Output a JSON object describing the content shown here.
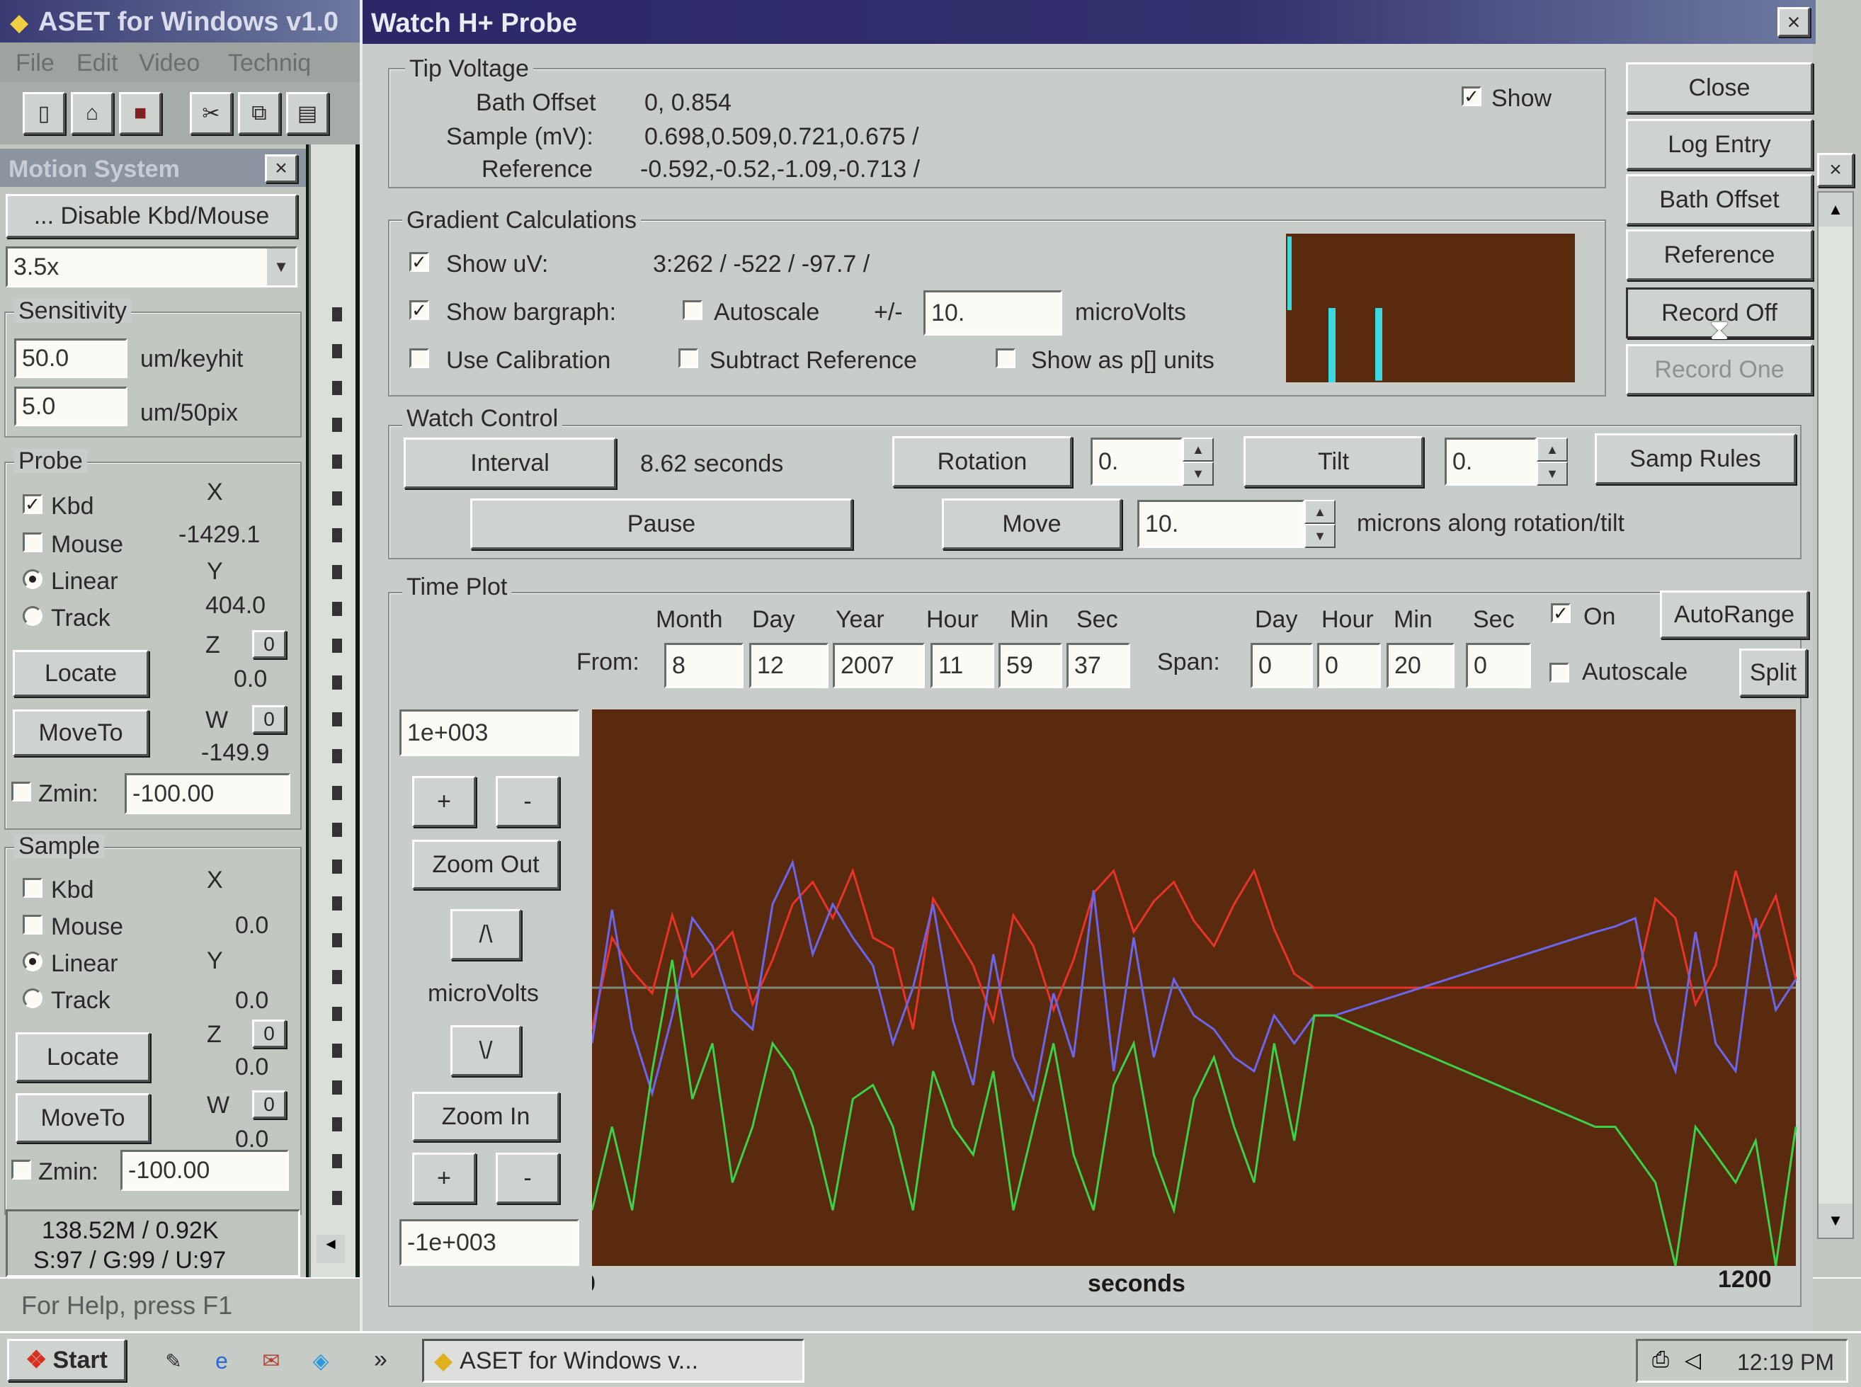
{
  "app": {
    "title": "ASET for Windows v1.0",
    "menu": [
      "File",
      "Edit",
      "Video",
      "Techniq"
    ],
    "status": "For Help, press F1"
  },
  "motion": {
    "title": "Motion System",
    "disable_btn": "... Disable Kbd/Mouse",
    "mag": "3.5x",
    "sensitivity": {
      "title": "Sensitivity",
      "v1": "50.0",
      "u1": "um/keyhit",
      "v2": "5.0",
      "u2": "um/50pix"
    },
    "probe": {
      "title": "Probe",
      "kbd": "Kbd",
      "mouse": "Mouse",
      "linear": "Linear",
      "track": "Track",
      "x_lbl": "X",
      "x": "-1429.1",
      "y_lbl": "Y",
      "y": "404.0",
      "z_lbl": "Z",
      "z": "0.0",
      "w_lbl": "W",
      "w": "-149.9",
      "zero": "0",
      "locate": "Locate",
      "moveto": "MoveTo",
      "zmin_lbl": "Zmin:",
      "zmin": "-100.00"
    },
    "sample": {
      "title": "Sample",
      "kbd": "Kbd",
      "mouse": "Mouse",
      "linear": "Linear",
      "track": "Track",
      "x_lbl": "X",
      "x": "0.0",
      "y_lbl": "Y",
      "y": "0.0",
      "z_lbl": "Z",
      "z": "0.0",
      "w_lbl": "W",
      "w": "0.0",
      "zero": "0",
      "locate": "Locate",
      "moveto": "MoveTo",
      "zmin_lbl": "Zmin:",
      "zmin": "-100.00"
    },
    "mem1": "138.52M / 0.92K",
    "mem2": "S:97 / G:99 / U:97"
  },
  "dialog": {
    "title": "Watch H+ Probe",
    "close_x": "×",
    "tip": {
      "title": "Tip Voltage",
      "bath_lbl": "Bath Offset",
      "bath": "0, 0.854",
      "sample_lbl": "Sample (mV):",
      "sample": "0.698,0.509,0.721,0.675 /",
      "ref_lbl": "Reference",
      "ref": "-0.592,-0.52,-1.09,-0.713 /",
      "show": "Show"
    },
    "grad": {
      "title": "Gradient Calculations",
      "show_uv": "Show uV:",
      "uv_values": "3:262 / -522 / -97.7 /",
      "show_bar": "Show bargraph:",
      "autoscale": "Autoscale",
      "pm": "+/-",
      "range": "10.",
      "microvolts": "microVolts",
      "use_cal": "Use Calibration",
      "sub_ref": "Subtract Reference",
      "show_p": "Show as p[] units"
    },
    "watch": {
      "title": "Watch Control",
      "interval_btn": "Interval",
      "interval": "8.62 seconds",
      "rotation_btn": "Rotation",
      "rotation": "0.",
      "tilt_btn": "Tilt",
      "tilt": "0.",
      "samp_rules": "Samp Rules",
      "pause": "Pause",
      "move": "Move",
      "move_val": "10.",
      "move_unit": "microns along rotation/tilt"
    },
    "time": {
      "title": "Time Plot",
      "h_month": "Month",
      "h_day": "Day",
      "h_year": "Year",
      "h_hour": "Hour",
      "h_min": "Min",
      "h_sec": "Sec",
      "from_lbl": "From:",
      "month": "8",
      "day": "12",
      "year": "2007",
      "hour": "11",
      "min": "59",
      "sec": "37",
      "s_day_h": "Day",
      "s_hour_h": "Hour",
      "s_min_h": "Min",
      "s_sec_h": "Sec",
      "span_lbl": "Span:",
      "s_day": "0",
      "s_hour": "0",
      "s_min": "20",
      "s_sec": "0",
      "on": "On",
      "autorange": "AutoRange",
      "autoscale": "Autoscale",
      "split": "Split",
      "ymax": "1e+003",
      "ymin": "-1e+003",
      "plus": "+",
      "minus": "-",
      "zoom_out": "Zoom Out",
      "zoom_in": "Zoom In",
      "up": "/\\",
      "down": "\\/",
      "unit": "microVolts"
    },
    "side": {
      "close": "Close",
      "log": "Log Entry",
      "bath": "Bath Offset",
      "ref": "Reference",
      "rec_off": "Record Off",
      "rec_one": "Record One"
    }
  },
  "taskbar": {
    "start": "Start",
    "task": "ASET for Windows v...",
    "time": "12:19 PM",
    "more": "»"
  },
  "colors": {
    "plot_bg": "#5a2a0f",
    "red": "#e8322a",
    "blue": "#6a66ee",
    "green": "#3ad24a",
    "cyan": "#3ad8e0",
    "dialog_title": "#2c2868"
  },
  "chart_data": {
    "type": "line",
    "xlabel": "seconds",
    "xlim": [
      0,
      1200
    ],
    "ylim": [
      -1000,
      1000
    ],
    "ylabel": "microVolts",
    "x": [
      0,
      20,
      40,
      60,
      80,
      100,
      120,
      140,
      160,
      180,
      200,
      220,
      240,
      260,
      280,
      300,
      320,
      340,
      360,
      380,
      400,
      420,
      440,
      460,
      480,
      500,
      520,
      540,
      560,
      580,
      600,
      620,
      640,
      660,
      680,
      700,
      720,
      740,
      1000,
      1020,
      1040,
      1060,
      1080,
      1100,
      1120,
      1140,
      1160,
      1180,
      1200
    ],
    "series": [
      {
        "color": "red",
        "values": [
          -150,
          180,
          60,
          -20,
          260,
          40,
          120,
          200,
          -60,
          100,
          300,
          380,
          250,
          420,
          180,
          140,
          -150,
          320,
          200,
          80,
          -120,
          260,
          150,
          -80,
          100,
          340,
          420,
          200,
          310,
          380,
          240,
          150,
          300,
          420,
          210,
          50,
          0,
          0,
          0,
          0,
          0,
          320,
          250,
          -60,
          80,
          420,
          180,
          330,
          30
        ]
      },
      {
        "color": "blue",
        "values": [
          -200,
          280,
          -150,
          -380,
          -100,
          250,
          150,
          -80,
          -150,
          300,
          450,
          120,
          300,
          180,
          80,
          -200,
          0,
          300,
          -120,
          -350,
          120,
          -250,
          -400,
          -20,
          -250,
          350,
          -300,
          180,
          -250,
          30,
          -100,
          -150,
          -250,
          -300,
          -100,
          -200,
          -100,
          -100,
          200,
          220,
          250,
          -120,
          -300,
          200,
          -200,
          -300,
          250,
          -80,
          30
        ]
      },
      {
        "color": "green",
        "values": [
          -800,
          -500,
          -800,
          -300,
          100,
          -400,
          -200,
          -700,
          -500,
          -200,
          -300,
          -500,
          -800,
          -400,
          -350,
          -500,
          -800,
          -300,
          -500,
          -600,
          -300,
          -800,
          -500,
          -200,
          -600,
          -800,
          -350,
          -200,
          -600,
          -800,
          -400,
          -250,
          -500,
          -700,
          -200,
          -550,
          -100,
          -100,
          -500,
          -500,
          -600,
          -700,
          -1000,
          -500,
          -600,
          -700,
          -550,
          -1000,
          -500
        ]
      }
    ]
  },
  "bargraph": {
    "bars": [
      -522,
      -97.7
    ],
    "range": 10
  }
}
